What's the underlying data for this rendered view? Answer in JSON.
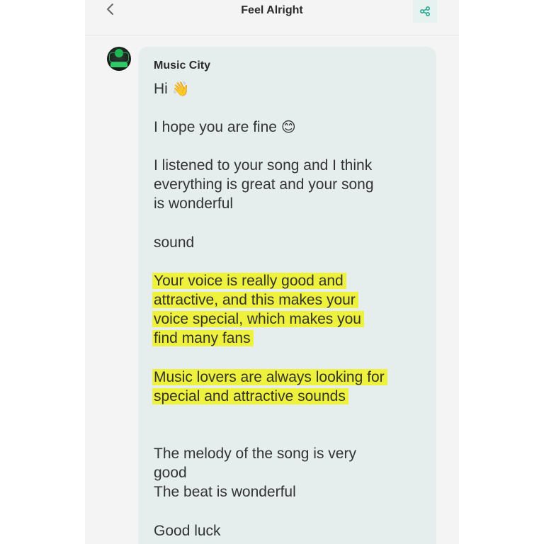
{
  "header": {
    "title": "Feel Alright"
  },
  "message": {
    "sender": "Music City",
    "lines": {
      "greeting": "Hi",
      "greeting_emoji": "👋",
      "hope": "I hope you are fine",
      "hope_emoji": "😊",
      "listened_1": "I listened to your song and I think",
      "listened_2": "everything is great and your song",
      "listened_3": "is wonderful",
      "sound": "sound",
      "voice_1": "Your voice is really good and",
      "voice_2": "attractive, and this makes your",
      "voice_3": "voice special, which makes you",
      "voice_4": "find many fans",
      "lovers_1": "Music lovers are always looking for",
      "lovers_2": "special and attractive sounds",
      "melody_1": "The melody of the song is very",
      "melody_2": "good",
      "beat": "The beat is wonderful",
      "luck": "Good luck"
    }
  },
  "colors": {
    "highlight": "#eef23c",
    "bubble": "#e6eeed",
    "accent": "#2aa98f"
  },
  "icons": {
    "back": "chevron-left-icon",
    "share": "share-icon",
    "avatar": "music-city-logo"
  }
}
